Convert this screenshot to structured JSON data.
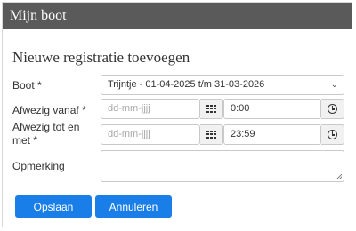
{
  "window": {
    "title": "Mijn boot"
  },
  "form": {
    "heading": "Nieuwe registratie toevoegen",
    "boat": {
      "label": "Boot *",
      "value": "Trijntje - 01-04-2025 t/m 31-03-2026"
    },
    "absent_from": {
      "label": "Afwezig vanaf *",
      "date_placeholder": "dd-mm-jjjj",
      "time_value": "0:00"
    },
    "absent_until": {
      "label_line1": "Afwezig tot en",
      "label_line2": "met *",
      "date_placeholder": "dd-mm-jjjj",
      "time_value": "23:59"
    },
    "remark": {
      "label": "Opmerking",
      "value": ""
    }
  },
  "buttons": {
    "save": "Opslaan",
    "cancel": "Annuleren"
  },
  "colors": {
    "titlebar": "#5a5a5a",
    "primary_button": "#1a7ee8"
  },
  "icons": {
    "calendar": "calendar-grid-icon",
    "clock": "clock-icon",
    "dropdown": "chevron-down-icon"
  }
}
